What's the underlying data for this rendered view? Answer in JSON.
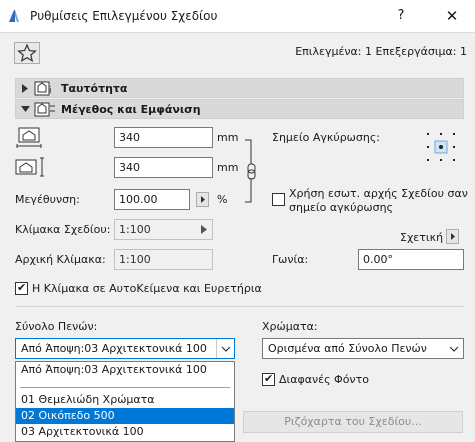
{
  "window": {
    "title": "Ρυθμίσεις Επιλεγμένου Σχεδίου",
    "help": "?",
    "close": "✕"
  },
  "header": {
    "selection_info": "Επιλεγμένα: 1 Επεξεργάσιμα: 1"
  },
  "sections": {
    "identity": "Ταυτότητα",
    "size": "Μέγεθος και Εμφάνιση"
  },
  "size": {
    "width_value": "340",
    "width_unit": "mm",
    "height_value": "340",
    "height_unit": "mm",
    "scale_label": "Μεγέθυνση:",
    "scale_value": "100.00",
    "scale_unit": "%",
    "drawing_scale_label": "Κλίμακα Σχεδίου:",
    "drawing_scale_value": "1:100",
    "original_scale_label": "Αρχική Κλίμακα:",
    "original_scale_value": "1:100"
  },
  "anchor": {
    "label": "Σημείο Αγκύρωσης:",
    "use_origin_label_line1": "Χρήση εσωτ. αρχής Σχεδίου σαν",
    "use_origin_label_line2": "σημείο αγκύρωσης",
    "relative_label": "Σχετική",
    "angle_label": "Γωνία:",
    "angle_value": "0.00°"
  },
  "options": {
    "scale_in_autotext_label": "Η Κλίμακα σε ΑυτοΚείμενα και Ευρετήρια"
  },
  "pens": {
    "pen_set_label": "Σύνολο Πενών:",
    "pen_set_value": "Από Άποψη:03 Αρχιτεκτονικά 100",
    "colors_label": "Χρώματα:",
    "colors_value": "Ορισμένα από Σύνολο Πενών",
    "transparent_bg_label": "Διαφανές Φόντο",
    "dropdown_items": [
      "Από Άποψη:03 Αρχιτεκτονικά 100",
      "01 Θεμελιώδη Χρώματα",
      "02 Οικόπεδο 500",
      "03 Αρχιτεκτονικά 100"
    ],
    "drawing_pens_button": "Ριζόχαρτα του Σχεδίου..."
  },
  "colors": {
    "accent": "#0078d7",
    "section_bg": "#d9d9d9",
    "panel_bg": "#f0f0f0"
  }
}
